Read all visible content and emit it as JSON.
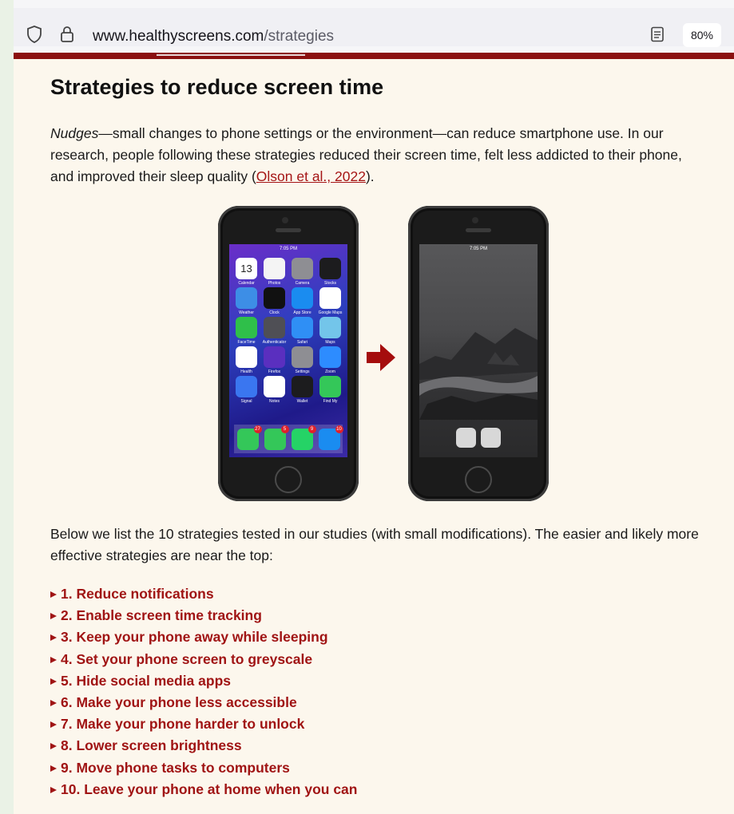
{
  "browser": {
    "url_domain": "www.healthyscreens.com",
    "url_path": "/strategies",
    "zoom": "80%"
  },
  "article": {
    "title": "Strategies to reduce screen time",
    "intro_em": "Nudges",
    "intro_text": "—small changes to phone settings or the environment—can reduce smartphone use. In our research, people following these strategies reduced their screen time, felt less addicted to their phone, and improved their sleep quality (",
    "citation": "Olson et al., 2022",
    "intro_end": ").",
    "lead": "Below we list the 10 strategies tested in our studies (with small modifications). The easier and likely more effective strategies are near the top:",
    "strategies": [
      "1. Reduce notifications",
      "2. Enable screen time tracking",
      "3. Keep your phone away while sleeping",
      "4. Set your phone screen to greyscale",
      "5. Hide social media apps",
      "6. Make your phone less accessible",
      "7. Make your phone harder to unlock",
      "8. Lower screen brightness",
      "9. Move phone tasks to computers",
      "10. Leave your phone at home when you can"
    ]
  },
  "phones": {
    "status_time": "7:05 PM",
    "calendar_date": "13",
    "apps": [
      {
        "label": "Calendar",
        "color": "#ffffff"
      },
      {
        "label": "Photos",
        "color": "#f4f4f4"
      },
      {
        "label": "Camera",
        "color": "#8e8e93"
      },
      {
        "label": "Stocks",
        "color": "#1c1c1e"
      },
      {
        "label": "Weather",
        "color": "#3d8ee6"
      },
      {
        "label": "Clock",
        "color": "#111111"
      },
      {
        "label": "App Store",
        "color": "#1a8cf0"
      },
      {
        "label": "Google Maps",
        "color": "#ffffff"
      },
      {
        "label": "FaceTime",
        "color": "#2fbf4a"
      },
      {
        "label": "Authenticator",
        "color": "#4f4f55"
      },
      {
        "label": "Safari",
        "color": "#2f8ff5"
      },
      {
        "label": "Maps",
        "color": "#73c5ea"
      },
      {
        "label": "Health",
        "color": "#ffffff"
      },
      {
        "label": "Firefox",
        "color": "#5a2fbf"
      },
      {
        "label": "Settings",
        "color": "#8e8e93"
      },
      {
        "label": "Zoom",
        "color": "#2d8cff"
      },
      {
        "label": "Signal",
        "color": "#3a76f0"
      },
      {
        "label": "Notes",
        "color": "#ffffff"
      },
      {
        "label": "Wallet",
        "color": "#1c1c1e"
      },
      {
        "label": "Find My",
        "color": "#34c759"
      }
    ],
    "dock": [
      {
        "name": "Messages",
        "color": "#34c759",
        "badge": "27"
      },
      {
        "name": "Phone",
        "color": "#34c759",
        "badge": "5"
      },
      {
        "name": "WhatsApp",
        "color": "#25d366",
        "badge": "9"
      },
      {
        "name": "Mail",
        "color": "#1a8cf0",
        "badge": "10"
      }
    ]
  },
  "colors": {
    "accent": "#8b1010",
    "link": "#a51515",
    "strategy": "#a01414",
    "page_bg": "#fcf7ed"
  }
}
